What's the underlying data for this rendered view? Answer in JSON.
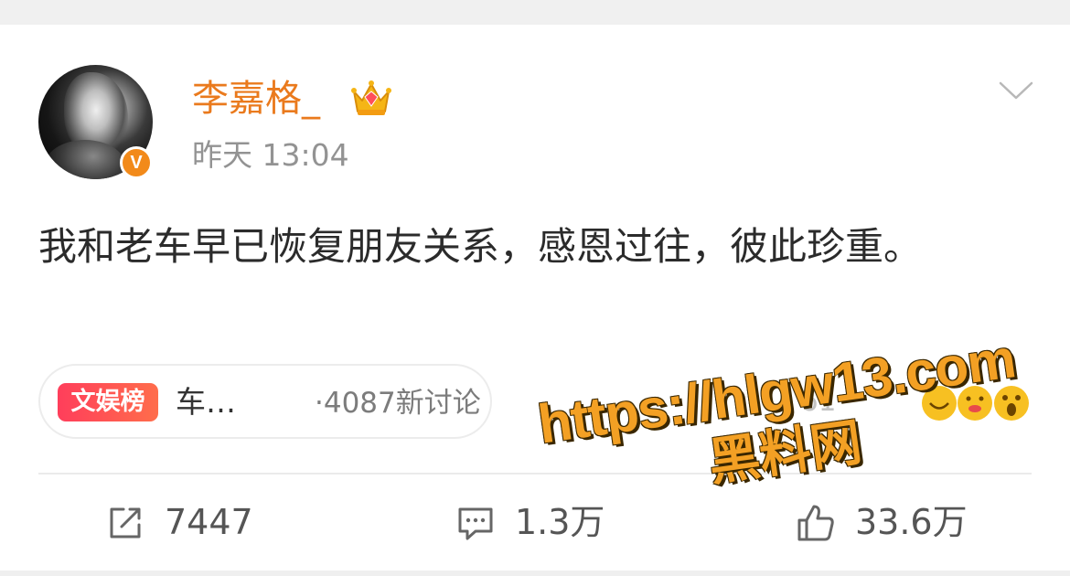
{
  "post": {
    "author": "李嘉格_",
    "timestamp": "昨天 13:04",
    "verified_badge": "V",
    "text": "我和老车早已恢复朋友关系，感恩过往，彼此珍重。",
    "icons": {
      "avatar": "user-avatar",
      "verified": "verified-v-badge-icon",
      "crown": "vip-crown-icon",
      "menu": "chevron-down-icon"
    }
  },
  "topic_chip": {
    "tag": "文娱榜",
    "title": "车…",
    "count": "·4087新讨论"
  },
  "views_partial": "61",
  "actions": {
    "repost": "7447",
    "comment": "1.3万",
    "like": "33.6万"
  },
  "watermark": {
    "url": "https://hlgw13.com",
    "name": "黑料网"
  },
  "colors": {
    "accent_orange": "#ea7a1d",
    "tag_red": "#ff3e5b",
    "muted_gray": "#939393"
  }
}
